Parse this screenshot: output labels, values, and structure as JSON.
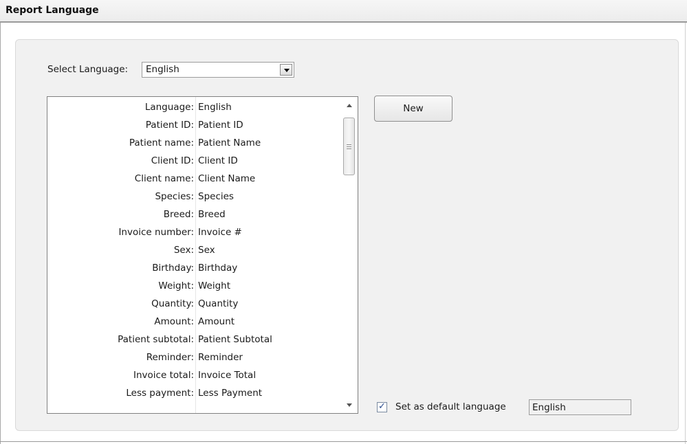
{
  "header": {
    "title": "Report Language"
  },
  "language_select": {
    "label": "Select Language:",
    "value": "English"
  },
  "fields": [
    {
      "label": "Language:",
      "value": "English"
    },
    {
      "label": "Patient ID:",
      "value": "Patient ID"
    },
    {
      "label": "Patient name:",
      "value": "Patient Name"
    },
    {
      "label": "Client ID:",
      "value": "Client ID"
    },
    {
      "label": "Client name:",
      "value": "Client Name"
    },
    {
      "label": "Species:",
      "value": "Species"
    },
    {
      "label": "Breed:",
      "value": "Breed"
    },
    {
      "label": "Invoice number:",
      "value": "Invoice #"
    },
    {
      "label": "Sex:",
      "value": "Sex"
    },
    {
      "label": "Birthday:",
      "value": "Birthday"
    },
    {
      "label": "Weight:",
      "value": "Weight"
    },
    {
      "label": "Quantity:",
      "value": "Quantity"
    },
    {
      "label": "Amount:",
      "value": "Amount"
    },
    {
      "label": "Patient subtotal:",
      "value": "Patient Subtotal"
    },
    {
      "label": "Reminder:",
      "value": "Reminder"
    },
    {
      "label": "Invoice total:",
      "value": "Invoice Total"
    },
    {
      "label": "Less payment:",
      "value": "Less Payment"
    }
  ],
  "buttons": {
    "new_label": "New"
  },
  "default_language": {
    "checked": true,
    "label": "Set as default language",
    "value": "English"
  },
  "icons": {
    "dropdown": "chevron-down-icon",
    "scroll_up": "arrow-up-icon",
    "scroll_down": "arrow-down-icon",
    "check": "check-icon"
  }
}
